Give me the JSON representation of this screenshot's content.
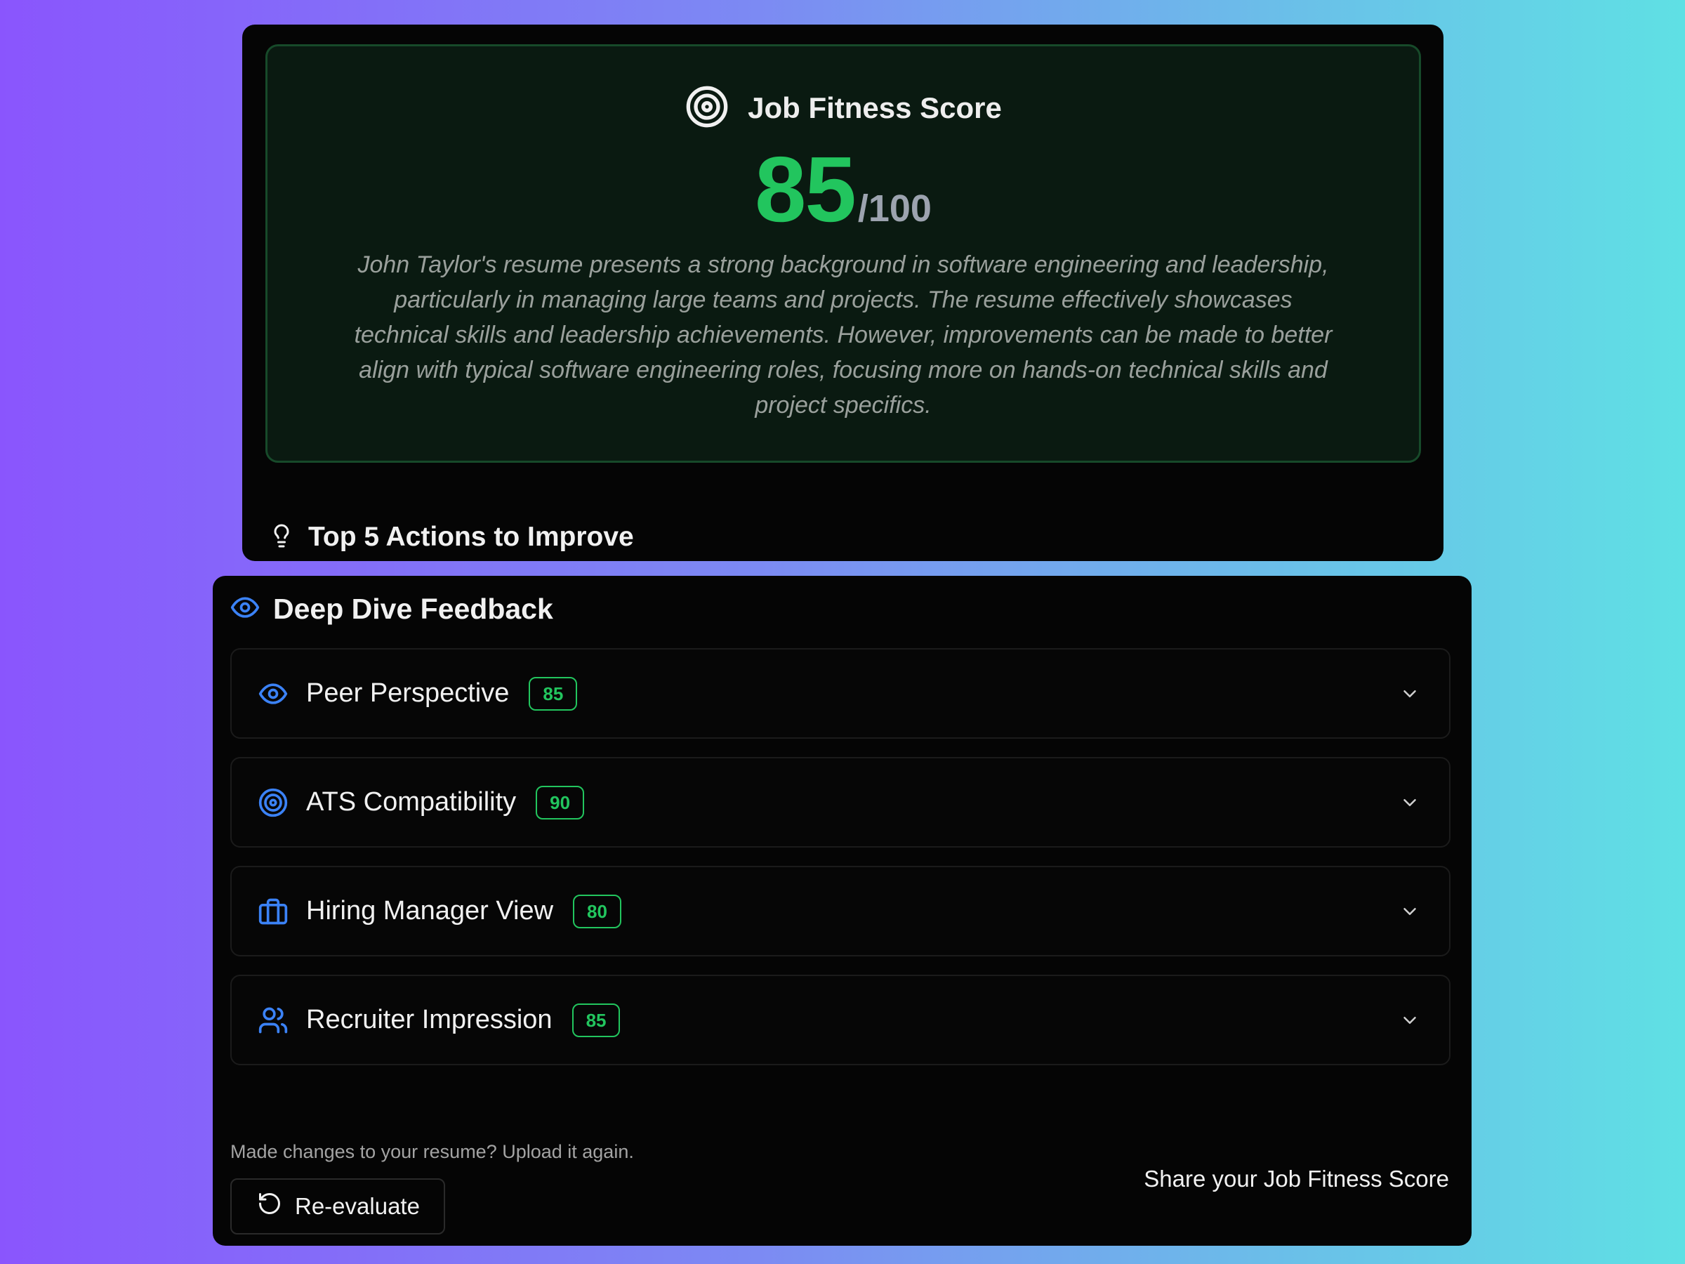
{
  "score_card": {
    "title": "Job Fitness Score",
    "title_icon": "target-icon",
    "score": "85",
    "max": "/100",
    "summary": "John Taylor's resume presents a strong background in software engineering and leadership, particularly in managing large teams and projects. The resume effectively showcases technical skills and leadership achievements. However, improvements can be made to better align with typical software engineering roles, focusing more on hands-on technical skills and project specifics."
  },
  "actions": {
    "title": "Top 5 Actions to Improve",
    "icon": "lightbulb-icon"
  },
  "deep_dive": {
    "title": "Deep Dive Feedback",
    "icon": "eye-icon",
    "items": [
      {
        "label": "Peer Perspective",
        "score": "85",
        "icon": "eye-icon"
      },
      {
        "label": "ATS Compatibility",
        "score": "90",
        "icon": "target-icon"
      },
      {
        "label": "Hiring Manager View",
        "score": "80",
        "icon": "briefcase-icon"
      },
      {
        "label": "Recruiter Impression",
        "score": "85",
        "icon": "users-icon"
      }
    ]
  },
  "footer": {
    "note": "Made changes to your resume? Upload it again.",
    "reevaluate_label": "Re-evaluate",
    "share_label": "Share your Job Fitness Score"
  },
  "colors": {
    "accent_green": "#22c55e",
    "accent_blue": "#3b82f6",
    "card_bg": "#050505"
  }
}
